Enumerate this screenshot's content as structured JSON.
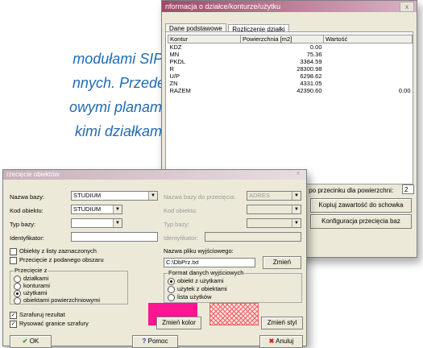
{
  "background_text": {
    "lines": [
      "modułami SIP,",
      "nnych.  Przede",
      "owymi planami",
      "kimi  działkami"
    ]
  },
  "dialog1": {
    "title": "nformacja o działce/konturze/użytku",
    "close_label": "x",
    "tabs": [
      "Dane podstawowe",
      "Rozliczenie działki"
    ],
    "active_tab": 1,
    "columns": [
      "Kontur",
      "Powierzchnia [m2]",
      "Wartość"
    ],
    "rows": [
      [
        "KDZ",
        "0.00",
        ""
      ],
      [
        "MN",
        "75.36",
        ""
      ],
      [
        "PKDL",
        "3384.59",
        ""
      ],
      [
        "R",
        "28300.98",
        ""
      ],
      [
        "U/P",
        "6298.62",
        ""
      ],
      [
        "ZN",
        "4331.05",
        ""
      ],
      [
        "RAZEM",
        "42390.60",
        "0.00"
      ]
    ],
    "precision_label": "sc po przecinku dla powierzchni:",
    "precision_value": "2",
    "copy_button": "Kopiuj zawartość do schowka",
    "config_button": "Konfiguracja przecięcia baz"
  },
  "dialog2": {
    "title": "rzecięcie obiektów",
    "close_label": "x",
    "base_name_label": "Nazwa bazy:",
    "base_name_value": "STUDIUM",
    "object_code_label": "Kod obiektu:",
    "object_code_value": "STUDIUM",
    "base_type_label": "Typ bazy:",
    "identifier_label": "Identyfikator:",
    "chk_selected_list": "Obiekty z listy zaznaczonych",
    "chk_given_area": "Przecięcie z podanego obszaru",
    "intersect_group": "Przecięcie z",
    "intersect_options": [
      "działkami",
      "konturami",
      "użytkami",
      "obiektami powierzchniowymi"
    ],
    "intersect_selected": 2,
    "chk_hatch": "Szrafuruj rezultat",
    "chk_draw_borders": "Rysować granice szrafury",
    "right_base_label": "Nazwa bazy do przecięcia:",
    "right_base_value": "ADRES",
    "right_code_label": "Kod obiektu:",
    "right_type_label": "Typ bazy:",
    "right_identifier_label": "Identyfikator:",
    "output_file_label": "Nazwa pliku wyjściowego:",
    "output_file_value": "C:\\DbPrz.txt",
    "change_button": "Zmień",
    "format_group": "Format danych wyjściowych",
    "format_options": [
      "obiekt z użytkami",
      "użytek z obiektami",
      "lista użytków"
    ],
    "format_selected": 0,
    "change_color_button": "Zmień kolor",
    "change_style_button": "Zmień styl",
    "ok_button": "OK",
    "help_button": "Pomoc",
    "cancel_button": "Anuluj",
    "colors": {
      "hatch_color": "#ff1493",
      "style_color": "#f06060"
    }
  }
}
